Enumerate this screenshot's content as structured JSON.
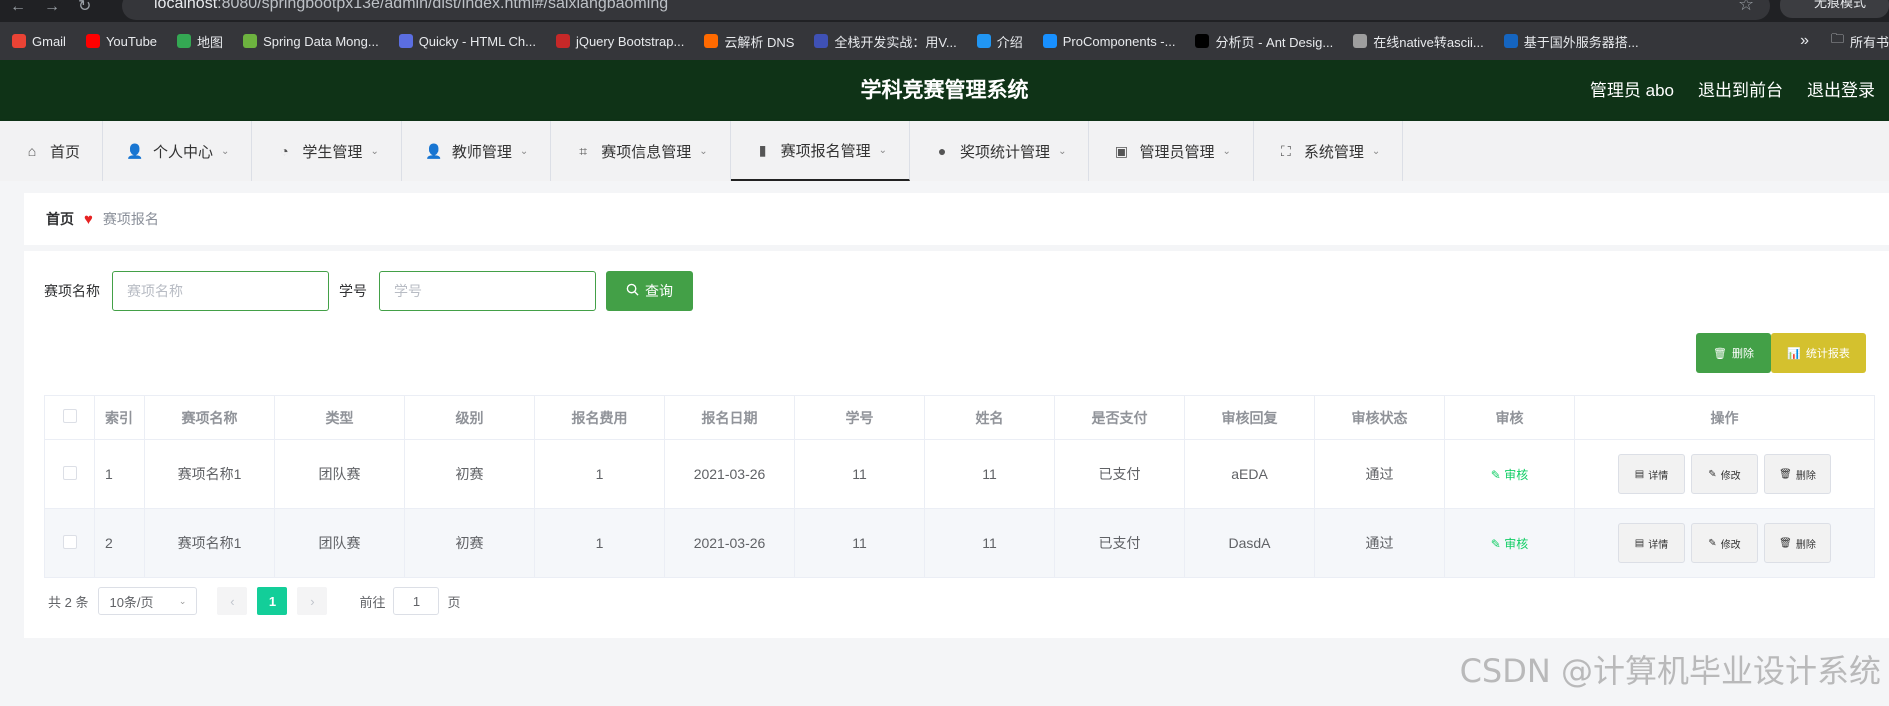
{
  "browser": {
    "url_host": "localhost",
    "url_path": ":8080/springbootpx13e/admin/dist/index.html#/saixiangbaoming",
    "incognito_label": "无痕模式",
    "bookmarks": [
      {
        "label": "Gmail",
        "color": "#ea4335"
      },
      {
        "label": "YouTube",
        "color": "#ff0000"
      },
      {
        "label": "地图",
        "color": "#34a853"
      },
      {
        "label": "Spring Data Mong...",
        "color": "#6db33f"
      },
      {
        "label": "Quicky - HTML Ch...",
        "color": "#5b6ee1"
      },
      {
        "label": "jQuery Bootstrap...",
        "color": "#c62828"
      },
      {
        "label": "云解析 DNS",
        "color": "#ff6a00"
      },
      {
        "label": "全栈开发实战：用V...",
        "color": "#3f51b5"
      },
      {
        "label": "介绍",
        "color": "#2196f3"
      },
      {
        "label": "ProComponents -...",
        "color": "#1890ff"
      },
      {
        "label": "分析页 - Ant Desig...",
        "color": "#000000"
      },
      {
        "label": "在线native转ascii...",
        "color": "#9e9e9e"
      },
      {
        "label": "基于国外服务器搭...",
        "color": "#1565c0"
      }
    ],
    "bookmarks_overflow": "»",
    "all_bookmarks": "所有书"
  },
  "header": {
    "title": "学科竞赛管理系统",
    "user": "管理员 abo",
    "front_link": "退出到前台",
    "logout": "退出登录"
  },
  "menu": [
    {
      "label": "首页",
      "icon": "home-icon",
      "chev": false
    },
    {
      "label": "个人中心",
      "icon": "user-icon",
      "chev": true
    },
    {
      "label": "学生管理",
      "icon": "dashboard-icon",
      "chev": true
    },
    {
      "label": "教师管理",
      "icon": "user-icon",
      "chev": true
    },
    {
      "label": "赛项信息管理",
      "icon": "crop-icon",
      "chev": true
    },
    {
      "label": "赛项报名管理",
      "icon": "bar-chart-icon",
      "chev": true,
      "active": true
    },
    {
      "label": "奖项统计管理",
      "icon": "balloon-icon",
      "chev": true
    },
    {
      "label": "管理员管理",
      "icon": "clipboard-icon",
      "chev": true
    },
    {
      "label": "系统管理",
      "icon": "fullscreen-icon",
      "chev": true
    }
  ],
  "breadcrumb": {
    "home": "首页",
    "current": "赛项报名"
  },
  "search": {
    "name_label": "赛项名称",
    "name_placeholder": "赛项名称",
    "id_label": "学号",
    "id_placeholder": "学号",
    "query_button": "查询"
  },
  "actions": {
    "delete": "删除",
    "stats": "统计报表"
  },
  "table": {
    "columns": [
      "索引",
      "赛项名称",
      "类型",
      "级别",
      "报名费用",
      "报名日期",
      "学号",
      "姓名",
      "是否支付",
      "审核回复",
      "审核状态",
      "审核",
      "操作"
    ],
    "rows": [
      {
        "index": "1",
        "name": "赛项名称1",
        "type": "团队赛",
        "level": "初赛",
        "fee": "1",
        "date": "2021-03-26",
        "student_id": "11",
        "student_name": "11",
        "paid": "已支付",
        "reply": "aEDA",
        "status": "通过"
      },
      {
        "index": "2",
        "name": "赛项名称1",
        "type": "团队赛",
        "level": "初赛",
        "fee": "1",
        "date": "2021-03-26",
        "student_id": "11",
        "student_name": "11",
        "paid": "已支付",
        "reply": "DasdA",
        "status": "通过"
      }
    ],
    "audit_label": "审核",
    "op_detail": "详情",
    "op_edit": "修改",
    "op_delete": "删除"
  },
  "pagination": {
    "total": "共 2 条",
    "page_size": "10条/页",
    "current_page": "1",
    "goto_prefix": "前往",
    "goto_value": "1",
    "goto_suffix": "页"
  },
  "watermark": "CSDN @计算机毕业设计系统",
  "colors": {
    "header_bg": "#0f3317",
    "primary": "#43a047",
    "warning": "#d4c12e",
    "page_active": "#13ce99"
  }
}
